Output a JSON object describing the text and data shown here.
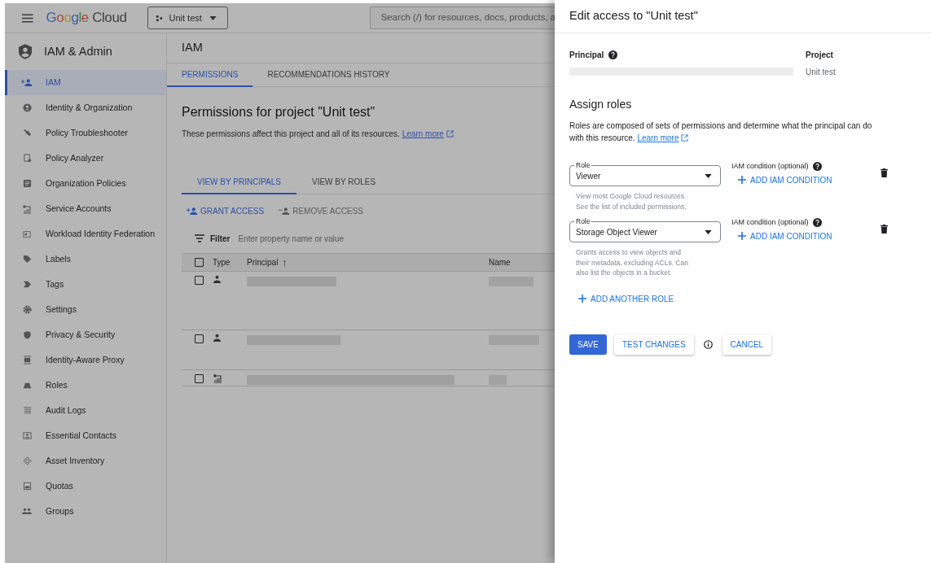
{
  "topbar": {
    "logo": "Google Cloud",
    "project": "Unit test",
    "search_placeholder": "Search (/) for resources, docs, products, a"
  },
  "sidebar": {
    "title": "IAM & Admin",
    "items": [
      {
        "label": "IAM",
        "selected": true
      },
      {
        "label": "Identity & Organization",
        "selected": false
      },
      {
        "label": "Policy Troubleshooter",
        "selected": false
      },
      {
        "label": "Policy Analyzer",
        "selected": false
      },
      {
        "label": "Organization Policies",
        "selected": false
      },
      {
        "label": "Service Accounts",
        "selected": false
      },
      {
        "label": "Workload Identity Federation",
        "selected": false
      },
      {
        "label": "Labels",
        "selected": false
      },
      {
        "label": "Tags",
        "selected": false
      },
      {
        "label": "Settings",
        "selected": false
      },
      {
        "label": "Privacy & Security",
        "selected": false
      },
      {
        "label": "Identity-Aware Proxy",
        "selected": false
      },
      {
        "label": "Roles",
        "selected": false
      },
      {
        "label": "Audit Logs",
        "selected": false
      },
      {
        "label": "Essential Contacts",
        "selected": false
      },
      {
        "label": "Asset Inventory",
        "selected": false
      },
      {
        "label": "Quotas",
        "selected": false
      },
      {
        "label": "Groups",
        "selected": false
      }
    ]
  },
  "main": {
    "title": "IAM",
    "tabs": [
      {
        "label": "PERMISSIONS",
        "selected": true
      },
      {
        "label": "RECOMMENDATIONS HISTORY",
        "selected": false
      }
    ],
    "heading": "Permissions for project \"Unit test\"",
    "description": "These permissions affect this project and all of its resources.",
    "learn_more": "Learn more",
    "view_tabs": [
      {
        "label": "VIEW BY PRINCIPALS",
        "selected": true
      },
      {
        "label": "VIEW BY ROLES",
        "selected": false
      }
    ],
    "actions": [
      {
        "label": "GRANT ACCESS",
        "disabled": false
      },
      {
        "label": "REMOVE ACCESS",
        "disabled": true
      }
    ],
    "filter": {
      "label": "Filter",
      "placeholder": "Enter property name or value"
    },
    "table": {
      "select_all_checked": false,
      "columns": [
        "Type",
        "Principal",
        "Name"
      ],
      "sort_arrow": "↑",
      "rows": [
        {
          "kind": "user",
          "checked": false
        },
        {
          "kind": "user",
          "checked": false
        },
        {
          "kind": "service_account",
          "checked": false
        }
      ]
    }
  },
  "panel": {
    "title": "Edit access to \"Unit test\"",
    "principal_label": "Principal",
    "project_label": "Project",
    "project_value": "Unit test",
    "assign_heading": "Assign roles",
    "assign_description": "Roles are composed of sets of permissions and determine what the principal can do with this resource.",
    "learn_more": "Learn more",
    "roles": [
      {
        "label": "Role",
        "value": "Viewer",
        "description": "View most Google Cloud resources. See the list of included permissions.",
        "condition_label": "IAM condition (optional)",
        "add_condition": "ADD IAM CONDITION"
      },
      {
        "label": "Role",
        "value": "Storage Object Viewer",
        "description": "Grants access to view objects and their metadata, excluding ACLs. Can also list the objects in a bucket.",
        "condition_label": "IAM condition (optional)",
        "add_condition": "ADD IAM CONDITION"
      }
    ],
    "add_role": "ADD ANOTHER ROLE",
    "buttons": [
      {
        "kind": "primary",
        "label": "SAVE"
      },
      {
        "kind": "secondary",
        "label": "TEST CHANGES"
      },
      {
        "kind": "info"
      },
      {
        "kind": "secondary",
        "label": "CANCEL"
      }
    ]
  }
}
